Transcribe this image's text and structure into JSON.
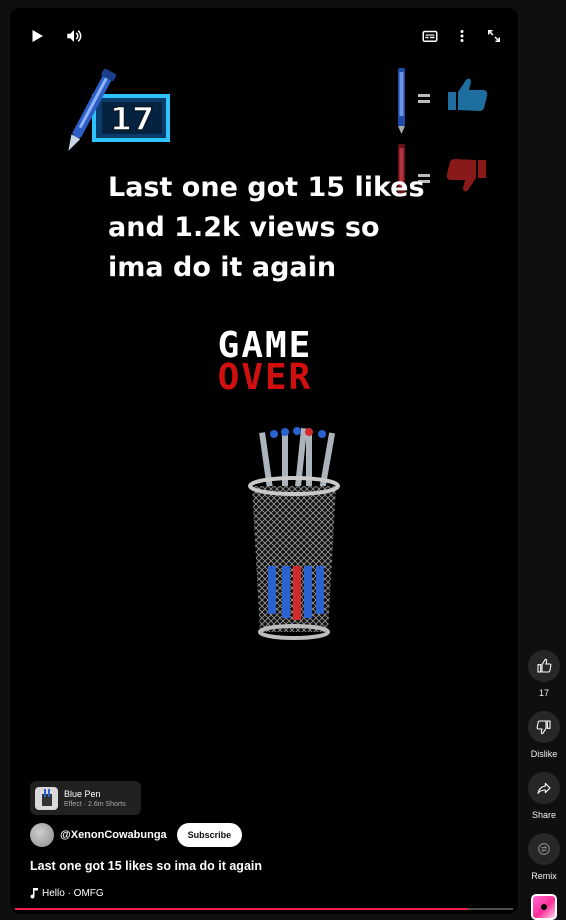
{
  "player": {
    "controls": {
      "play_icon": "play-icon",
      "volume_icon": "volume-icon",
      "captions_icon": "captions-icon",
      "more_icon": "more-vert-icon",
      "fullscreen_icon": "fullscreen-icon"
    },
    "video": {
      "badge_number": "17",
      "overlay_text": "Last one got 15 likes and 1.2k views so ima do it again",
      "game_over_line1": "GAME",
      "game_over_line2": "OVER",
      "colors": {
        "game_over_red": "#d10f0f",
        "like_blue": "#1e6fa0",
        "dislike_red": "#8a1a1a"
      }
    },
    "progress_fraction": 0.91
  },
  "effect": {
    "name": "Blue Pen",
    "subtitle": "Effect · 2.6m Shorts"
  },
  "channel": {
    "handle": "@XenonCowabunga",
    "subscribe_label": "Subscribe"
  },
  "title": "Last one got 15 likes so ima do it again",
  "music": {
    "icon": "music-note-icon",
    "text": "Hello · OMFG"
  },
  "actions": {
    "like_count": "17",
    "dislike_label": "Dislike",
    "share_label": "Share",
    "remix_label": "Remix"
  },
  "colors": {
    "progress": "#f1224e",
    "background": "#0f0f0f"
  }
}
